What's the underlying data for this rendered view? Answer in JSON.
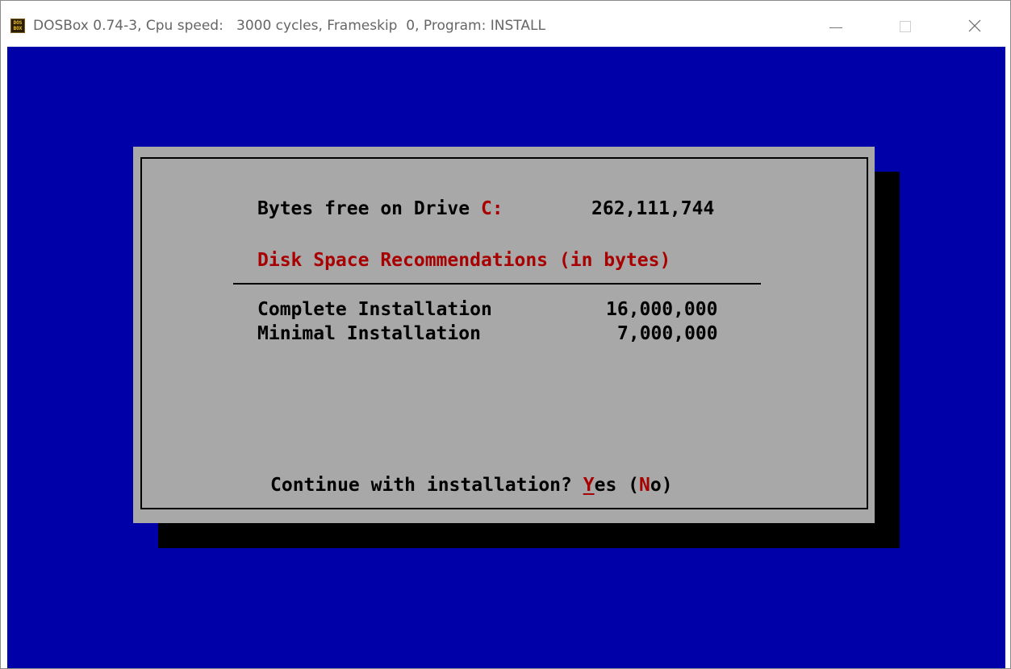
{
  "window": {
    "icon_lines": [
      "DOS",
      "BOX"
    ],
    "title": "DOSBox 0.74-3, Cpu speed:   3000 cycles, Frameskip  0, Program: INSTALL",
    "controls": [
      "minimize-icon",
      "maximize-icon",
      "close-icon"
    ]
  },
  "dialog": {
    "bytes_free_label": "Bytes free on Drive ",
    "drive_letter": "C:",
    "bytes_free_value": "262,111,744",
    "recommendations_heading": "Disk Space Recommendations (in bytes)",
    "rows": [
      {
        "label": "Complete Installation",
        "value": "16,000,000"
      },
      {
        "label": "Minimal Installation",
        "value": "7,000,000"
      }
    ],
    "prompt": "Continue with installation? ",
    "yes_hotkey": "Y",
    "yes_rest": "es",
    "no_open": "(",
    "no_hotkey": "N",
    "no_rest": "o)"
  },
  "colors": {
    "screen_background": "#0000a8",
    "dialog_background": "#a8a8a8",
    "highlight_red": "#a80000",
    "shadow": "#000000"
  }
}
